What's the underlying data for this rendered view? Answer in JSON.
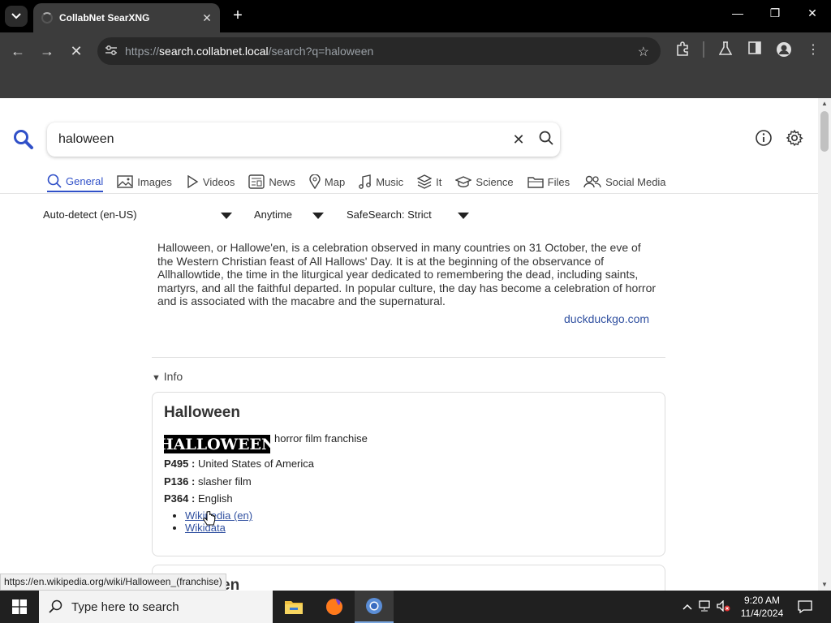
{
  "browser": {
    "tab_title": "CollabNet SearXNG",
    "url_scheme": "https://",
    "url_host": "search.collabnet.local",
    "url_path": "/search?q=haloween"
  },
  "search": {
    "query": "haloween"
  },
  "categories": [
    {
      "label": "General",
      "icon": "search-icon",
      "active": true
    },
    {
      "label": "Images",
      "icon": "image-icon"
    },
    {
      "label": "Videos",
      "icon": "play-icon"
    },
    {
      "label": "News",
      "icon": "newspaper-icon"
    },
    {
      "label": "Map",
      "icon": "map-pin-icon"
    },
    {
      "label": "Music",
      "icon": "music-note-icon"
    },
    {
      "label": "It",
      "icon": "layers-icon"
    },
    {
      "label": "Science",
      "icon": "graduation-cap-icon"
    },
    {
      "label": "Files",
      "icon": "folder-icon"
    },
    {
      "label": "Social Media",
      "icon": "people-icon"
    }
  ],
  "filters": {
    "language": "Auto-detect (en-US)",
    "time": "Anytime",
    "safesearch": "SafeSearch: Strict"
  },
  "answer": {
    "text": "Halloween, or Hallowe'en, is a celebration observed in many countries on 31 October, the eve of the Western Christian feast of All Hallows' Day. It is at the beginning of the observance of Allhallowtide, the time in the liturgical year dedicated to remembering the dead, including saints, martyrs, and all the faithful departed. In popular culture, the day has become a celebration of horror and is associated with the macabre and the supernatural.",
    "source": "duckduckgo.com"
  },
  "info_toggle": "Info",
  "infobox": {
    "title": "Halloween",
    "logo_text": "HALLOWEEN",
    "description": "horror film franchise",
    "rows": [
      {
        "key": "P495 :",
        "value": "United States of America"
      },
      {
        "key": "P136 :",
        "value": "slasher film"
      },
      {
        "key": "P364 :",
        "value": "English"
      }
    ],
    "links": [
      "Wikipedia (en)",
      "Wikidata"
    ]
  },
  "infobox2": {
    "title_fragment": "en"
  },
  "status_url": "https://en.wikipedia.org/wiki/Halloween_(franchise)",
  "taskbar": {
    "search_placeholder": "Type here to search",
    "time": "9:20 AM",
    "date": "11/4/2024"
  },
  "colors": {
    "accent": "#3050c8",
    "link": "#3050a0"
  }
}
